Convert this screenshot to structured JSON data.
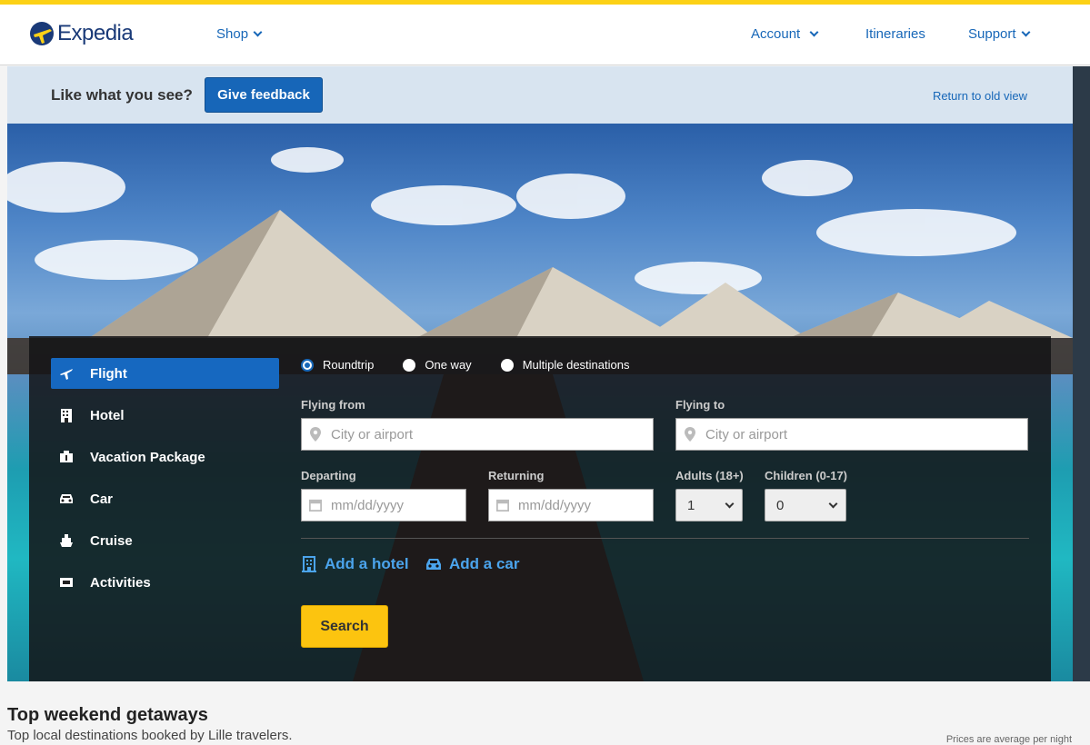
{
  "brand": {
    "name": "Expedia",
    "accent": "#fcd116",
    "link_color": "#1767b8"
  },
  "nav": {
    "shop": "Shop",
    "account": "Account",
    "itineraries": "Itineraries",
    "support": "Support"
  },
  "feedback": {
    "prompt": "Like what you see?",
    "button": "Give feedback",
    "return_link": "Return to old view"
  },
  "search": {
    "tabs": [
      {
        "label": "Flight",
        "icon": "plane-icon",
        "active": true
      },
      {
        "label": "Hotel",
        "icon": "building-icon"
      },
      {
        "label": "Vacation Package",
        "icon": "package-icon"
      },
      {
        "label": "Car",
        "icon": "car-icon"
      },
      {
        "label": "Cruise",
        "icon": "ship-icon"
      },
      {
        "label": "Activities",
        "icon": "ticket-icon"
      }
    ],
    "trip_types": [
      "Roundtrip",
      "One way",
      "Multiple destinations"
    ],
    "selected_trip_type": "Roundtrip",
    "flying_from": {
      "label": "Flying from",
      "placeholder": "City or airport"
    },
    "flying_to": {
      "label": "Flying to",
      "placeholder": "City or airport"
    },
    "departing": {
      "label": "Departing",
      "placeholder": "mm/dd/yyyy"
    },
    "returning": {
      "label": "Returning",
      "placeholder": "mm/dd/yyyy"
    },
    "adults": {
      "label": "Adults (18+)",
      "value": "1"
    },
    "children": {
      "label": "Children (0-17)",
      "value": "0"
    },
    "add_hotel": "Add a hotel",
    "add_car": "Add a car",
    "search_button": "Search"
  },
  "getaways": {
    "title": "Top weekend getaways",
    "subtitle": "Top local destinations booked by Lille travelers.",
    "note": "Prices are average per night"
  }
}
